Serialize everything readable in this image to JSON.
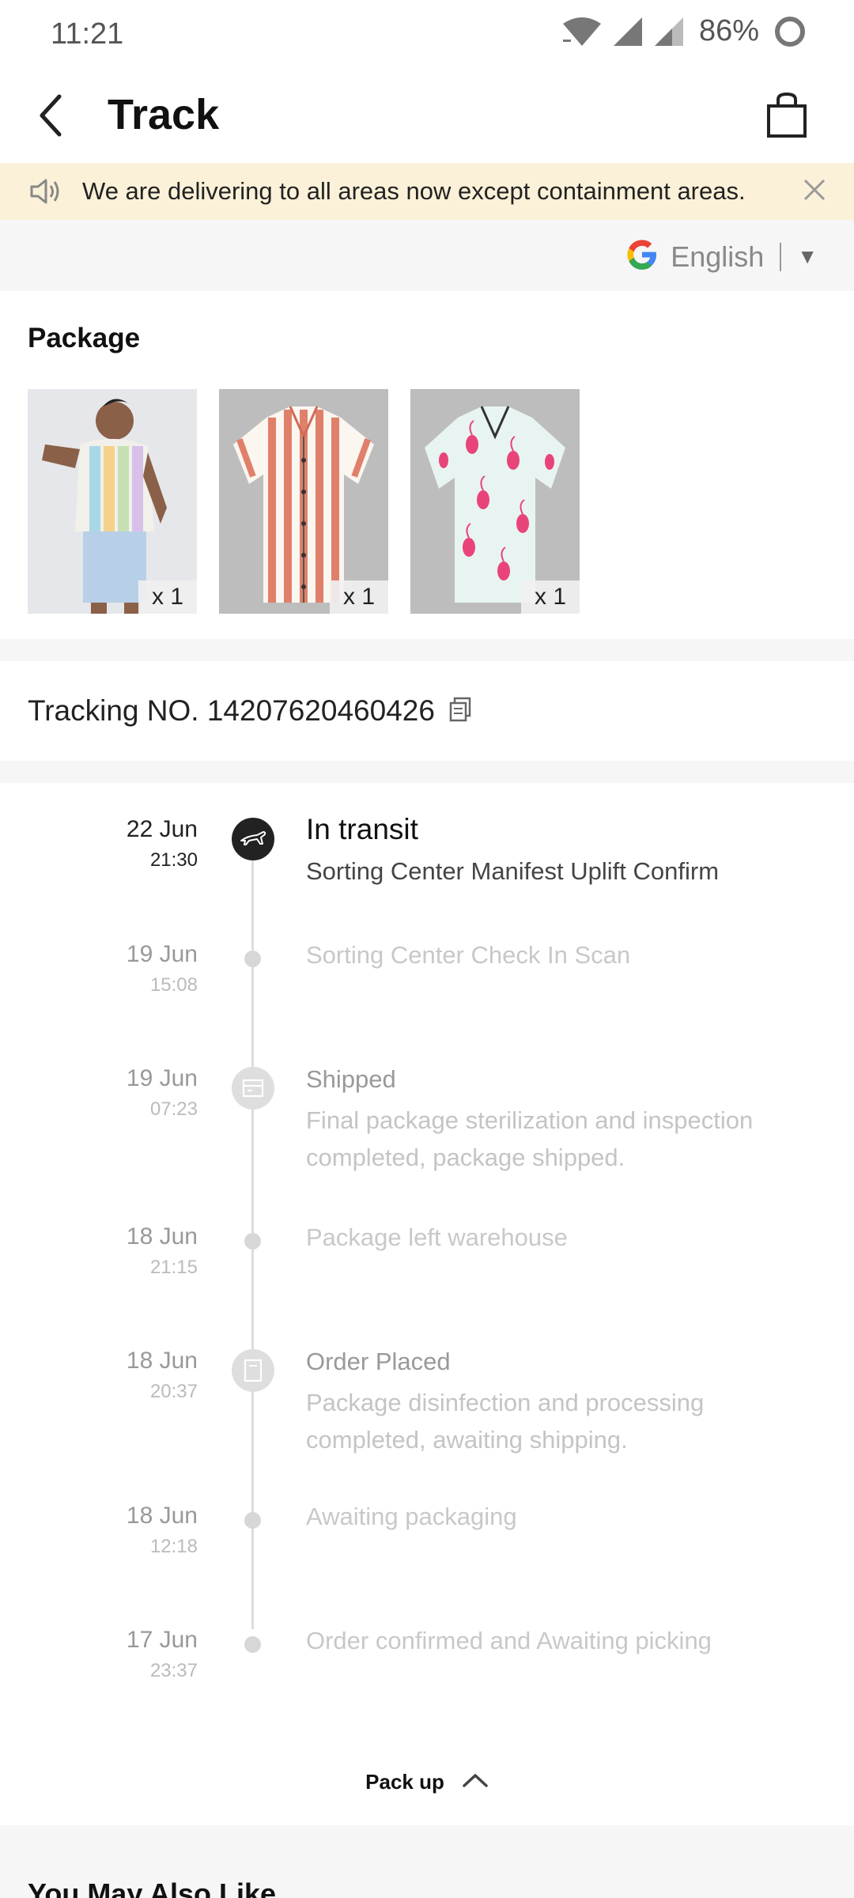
{
  "status_bar": {
    "time": "11:21",
    "battery_percent": "86%",
    "icons": [
      "wifi-icon",
      "signal-icon",
      "signal-weak-icon",
      "battery-ring-icon"
    ]
  },
  "app_bar": {
    "title": "Track",
    "back_icon": "chevron-left-icon",
    "bag_icon": "shopping-bag-icon"
  },
  "notice": {
    "text": "We are delivering to all areas now except containment areas.",
    "icon": "speaker-icon",
    "close_icon": "close-icon"
  },
  "translate": {
    "language": "English",
    "caret": "▼",
    "logo": "google-logo"
  },
  "package": {
    "title": "Package",
    "items": [
      {
        "qty": "x  1",
        "description": "model wearing pastel striped shirt"
      },
      {
        "qty": "x  1",
        "description": "red and white striped shirt"
      },
      {
        "qty": "x  1",
        "description": "flamingo print shirt"
      }
    ]
  },
  "tracking": {
    "label": "Tracking NO. 14207620460426"
  },
  "timeline": [
    {
      "date": "22 Jun",
      "time": "21:30",
      "title": "In transit",
      "desc": "Sorting Center Manifest Uplift Confirm",
      "icon": "airplane-icon",
      "active": true
    },
    {
      "date": "19 Jun",
      "time": "15:08",
      "desc": "Sorting Center Check In Scan"
    },
    {
      "date": "19 Jun",
      "time": "07:23",
      "title": "Shipped",
      "desc": "Final package sterilization and inspection completed, package shipped.",
      "icon": "package-box-icon"
    },
    {
      "date": "18 Jun",
      "time": "21:15",
      "desc": "Package left warehouse"
    },
    {
      "date": "18 Jun",
      "time": "20:37",
      "title": "Order Placed",
      "desc": "Package disinfection and processing completed, awaiting shipping.",
      "icon": "document-icon"
    },
    {
      "date": "18 Jun",
      "time": "12:18",
      "desc": "Awaiting packaging"
    },
    {
      "date": "17 Jun",
      "time": "23:37",
      "desc": "Order confirmed and Awaiting picking"
    }
  ],
  "pack_up": {
    "label": "Pack up",
    "icon": "chevron-up-icon"
  },
  "recommendations": {
    "title": "You May Also Like"
  },
  "colors": {
    "notice_bg": "#fbf1d8",
    "section_gap": "#f6f6f6",
    "active_dot": "#222222",
    "inactive_dot": "#d7d7d7"
  }
}
